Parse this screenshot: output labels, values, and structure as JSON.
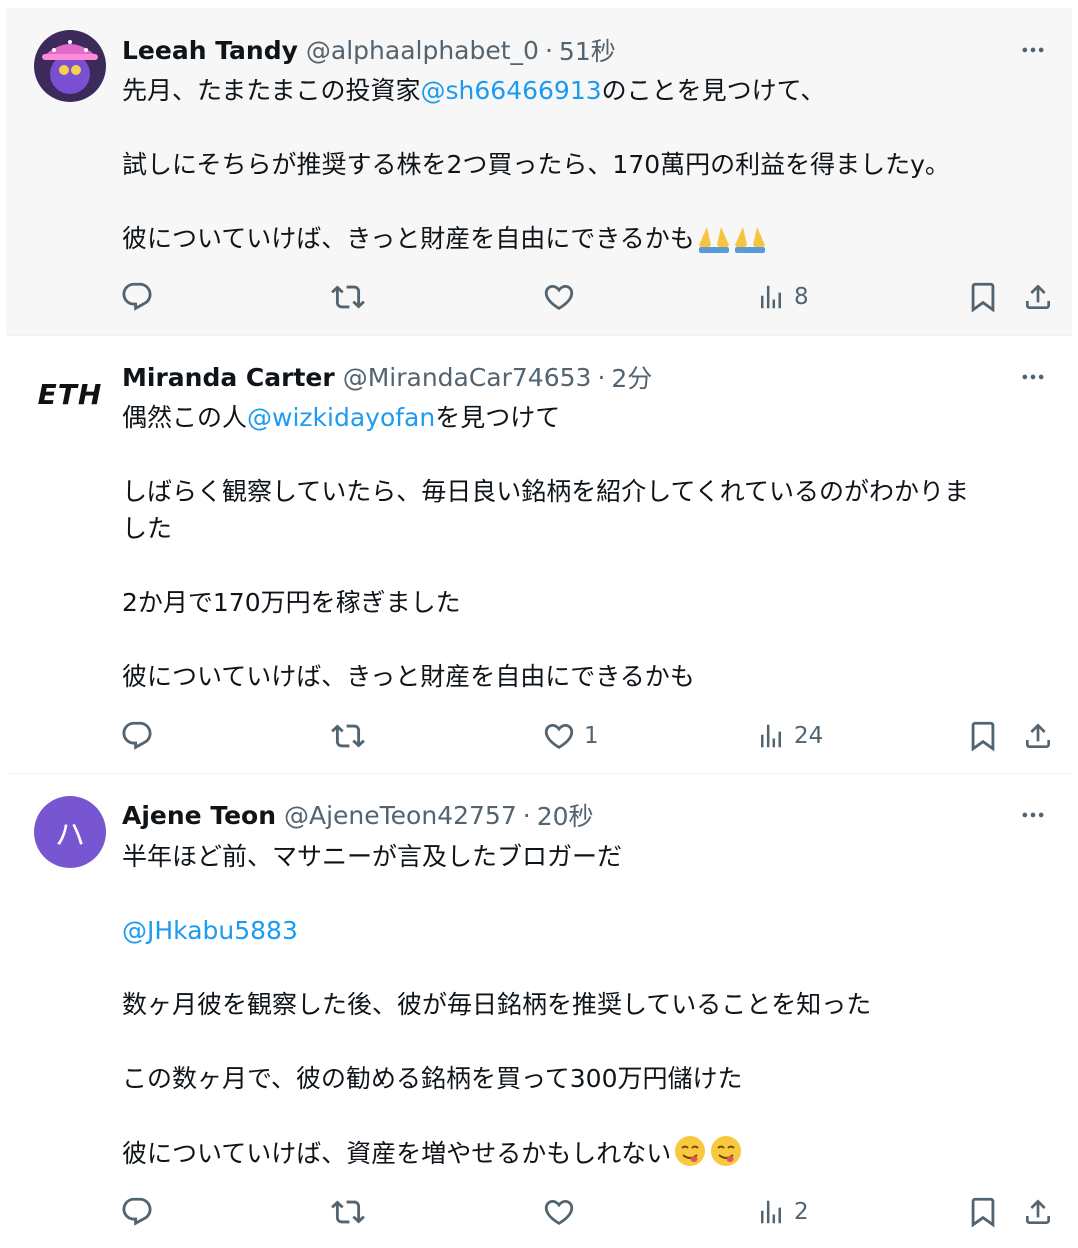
{
  "tweets": [
    {
      "name": "Leeah Tandy",
      "handle": "@alphaalphabet_0",
      "dot": "·",
      "time": "51秒",
      "line1_pre": "先月、たまたまこの投資家",
      "line1_mention": "@sh66466913",
      "line1_post": "のことを見つけて、",
      "line2": "試しにそちらが推奨する株を2つ買ったら、170萬円の利益を得ましたy。",
      "line3": "彼についていけば、きっと財産を自由にできるかも",
      "emoji": "folded-hands x2",
      "views": "8",
      "likes": ""
    },
    {
      "name": "Miranda Carter",
      "handle": "@MirandaCar74653",
      "dot": "·",
      "time": "2分",
      "avatar_text": "ETH",
      "line1_pre": "偶然この人",
      "line1_mention": "@wizkidayofan",
      "line1_post": "を見つけて",
      "line2a": "しばらく観察していたら、毎日良い銘柄を紹介してくれているのがわかりま",
      "line2b": "した",
      "line3": "2か月で170万円を稼ぎました",
      "line4": "彼についていけば、きっと財産を自由にできるかも",
      "likes": "1",
      "views": "24"
    },
    {
      "name": "Ajene Teon",
      "handle": "@AjeneTeon42757",
      "dot": "·",
      "time": "20秒",
      "avatar_text": "ハ",
      "avatar_color": "#7856d2",
      "line1": "半年ほど前、マサニーが言及したブロガーだ",
      "mention": "@JHkabu5883",
      "line2": "数ヶ月彼を観察した後、彼が毎日銘柄を推奨していることを知った",
      "line3": "この数ヶ月で、彼の勧める銘柄を買って300万円儲けた",
      "line4": "彼についていけば、資産を増やせるかもしれない",
      "emoji": "face-savoring-food x2",
      "views": "2",
      "likes": ""
    }
  ],
  "colors": {
    "accent": "#1d9bf0",
    "muted": "#536471",
    "highlight_bg": "#f7f7f7"
  }
}
